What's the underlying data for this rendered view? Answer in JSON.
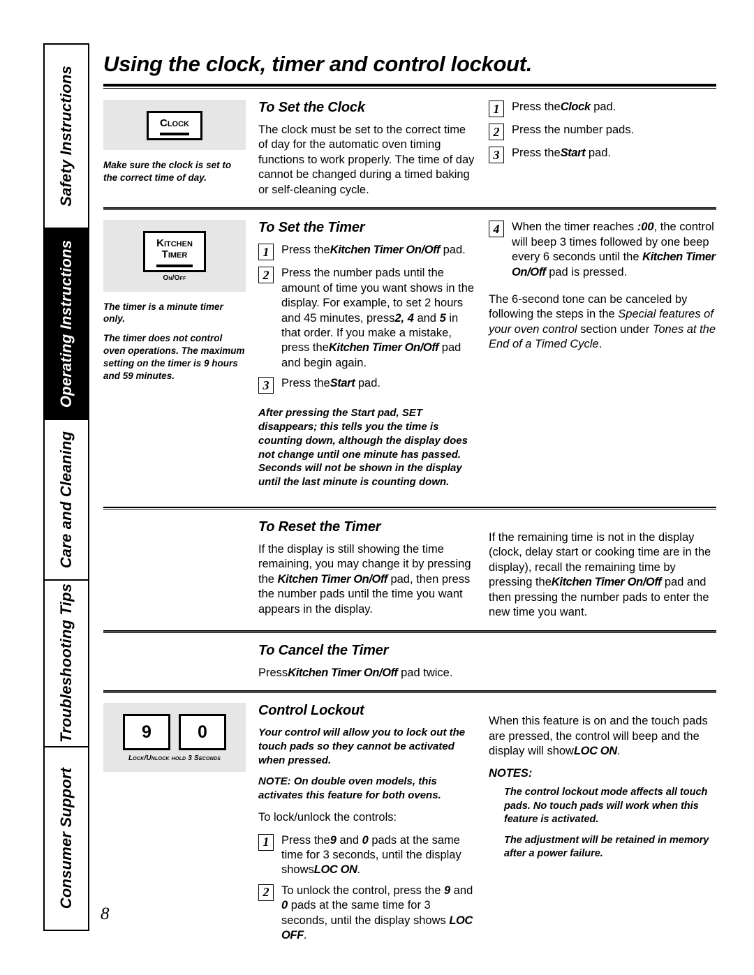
{
  "page": {
    "title": "Using the clock, timer and control lockout.",
    "number": "8"
  },
  "sidebar": {
    "tabs": [
      {
        "label": "Safety Instructions",
        "active": false
      },
      {
        "label": "Operating Instructions",
        "active": true
      },
      {
        "label": "Care and Cleaning",
        "active": false
      },
      {
        "label": "Troubleshooting Tips",
        "active": false
      },
      {
        "label": "Consumer Support",
        "active": false
      }
    ]
  },
  "clock_section": {
    "illustration": {
      "pad_label": "Clock",
      "note": "Make sure the clock is set to the correct time of day."
    },
    "heading": "To Set the Clock",
    "body": "The clock must be set to the correct time of day for the automatic oven timing functions to work properly. The time of day cannot be changed during a timed baking or self-cleaning cycle.",
    "steps": [
      {
        "num": "1",
        "pre": "Press the",
        "pad": "Clock",
        "post": " pad."
      },
      {
        "num": "2",
        "pre": "Press the number pads.",
        "pad": "",
        "post": ""
      },
      {
        "num": "3",
        "pre": "Press the",
        "pad": "Start",
        "post": " pad."
      }
    ]
  },
  "set_timer_section": {
    "illustration": {
      "pad_line1": "Kitchen",
      "pad_line2": "Timer",
      "pad_caption": "On/Off",
      "note1": "The timer is a minute timer only.",
      "note2": "The timer does not control oven operations. The maximum setting on the timer is 9 hours and 59 minutes."
    },
    "heading": "To Set the Timer",
    "step1": {
      "num": "1",
      "pre": "Press the",
      "pad": "Kitchen Timer On/Off",
      "post": " pad."
    },
    "step2": {
      "num": "2",
      "t1": "Press the number pads until the amount of time you want shows in the display. For example, to set 2 hours and 45 minutes, press",
      "b1": "2, 4",
      "t2": " and ",
      "b2": "5",
      "t3": " in that order. If you make a mistake, press the",
      "b3": "Kitchen Timer On/Off",
      "t4": " pad and begin again."
    },
    "step3": {
      "num": "3",
      "pre": "Press the",
      "pad": "Start",
      "post": " pad."
    },
    "step4": {
      "num": "4",
      "t1": "When the timer reaches ",
      "b1": ":00",
      "t2": ", the control will beep 3 times followed by one beep every 6 seconds until the ",
      "b2": "Kitchen Timer On/Off",
      "t3": " pad is pressed."
    },
    "tone_note": {
      "t1": "The 6-second tone can be canceled by following the steps in the ",
      "i1": "Special features of your oven control",
      "t2": " section under ",
      "i2": "Tones at the End of a Timed Cycle",
      "t3": "."
    },
    "set_note": {
      "t1": "After pressing the ",
      "b1": "Start",
      "t2": " pad, ",
      "b2": "SET",
      "t3": " disappears; this tells you the time is counting down, although the display does not change until one minute has passed. Seconds will not be shown in the display until the last minute is counting down."
    }
  },
  "reset_timer_section": {
    "heading": "To Reset the Timer",
    "left": {
      "t1": "If the display is still showing the time remaining, you may change it by pressing the ",
      "b1": "Kitchen Timer On/Off",
      "t2": " pad, then press the number pads until the time you want appears in the display."
    },
    "right": {
      "t1": "If the remaining time is not in the display (clock, delay start or cooking time are in the display), recall the remaining time by pressing the",
      "b1": "Kitchen Timer On/Off",
      "t2": " pad and then pressing the number pads to enter the new time you want."
    }
  },
  "cancel_timer_section": {
    "heading": "To Cancel the Timer",
    "t1": "Press",
    "b1": "Kitchen Timer On/Off",
    "t2": " pad twice."
  },
  "lockout_section": {
    "illustration": {
      "pad_left": "9",
      "pad_right": "0",
      "caption": "Lock/Unlock hold 3 Seconds"
    },
    "heading": "Control Lockout",
    "intro": "Your control will allow you to lock out the touch pads so they cannot be activated when pressed.",
    "note_label": "NOTE:",
    "note_text": " On double oven models, this activates this feature for both ovens.",
    "lead_in": "To lock/unlock the controls:",
    "steps": [
      {
        "num": "1",
        "t1": "Press the",
        "b1": "9",
        "t2": " and ",
        "b2": "0",
        "t3": " pads at the same time for 3 seconds, until the display shows",
        "b3": "LOC ON",
        "t4": "."
      },
      {
        "num": "2",
        "t1": "To unlock the control, press the ",
        "b1": "9",
        "t2": " and ",
        "b2": "0",
        "t3": " pads at the same time for 3 seconds, until the display shows ",
        "b3": "LOC OFF",
        "t4": "."
      }
    ],
    "right": {
      "t1": "When this feature is on and the touch pads are pressed, the control will beep and the display will show",
      "b1": "LOC ON",
      "t2": ".",
      "notes_head": "NOTES:",
      "notes": [
        "The control lockout mode affects all touch pads. No touch pads will work when this feature is activated.",
        "The adjustment will be retained in memory after a power failure."
      ]
    }
  }
}
